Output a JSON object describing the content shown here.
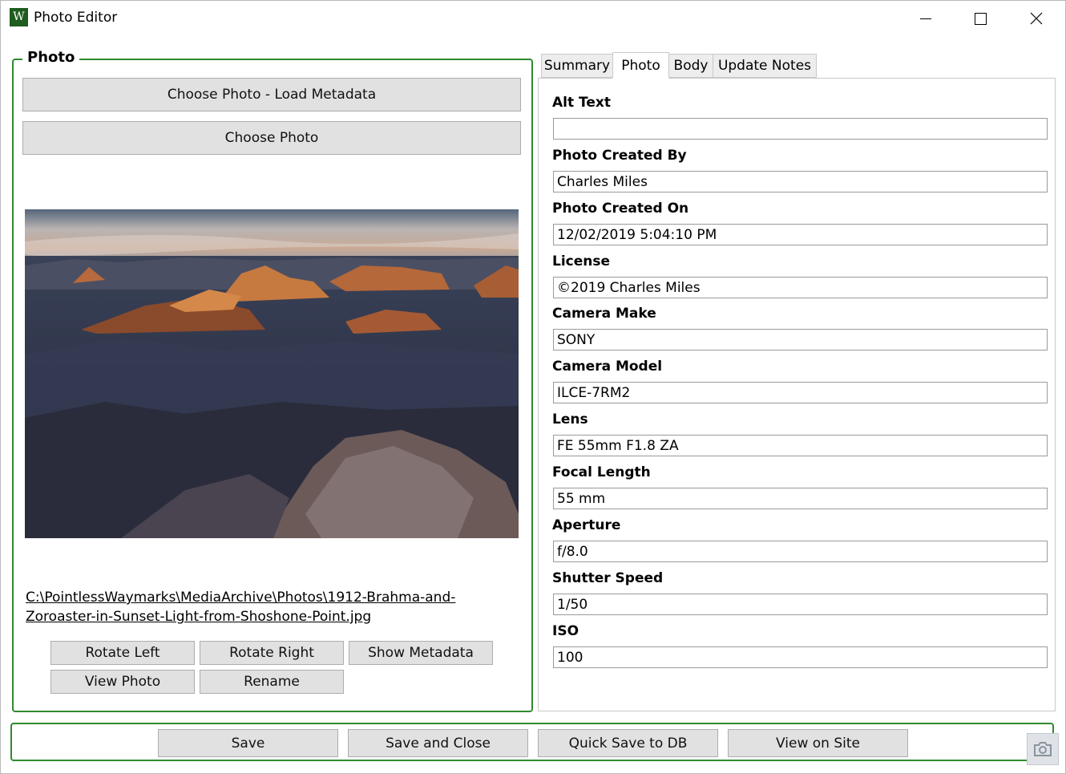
{
  "window": {
    "title": "Photo Editor",
    "icon_letter": "W"
  },
  "photo_group": {
    "legend": "Photo",
    "choose_load_metadata": "Choose Photo - Load Metadata",
    "choose_photo": "Choose Photo",
    "file_path": "C:\\PointlessWaymarks\\MediaArchive\\Photos\\1912-Brahma-and-Zoroaster-in-Sunset-Light-from-Shoshone-Point.jpg",
    "buttons": {
      "rotate_left": "Rotate Left",
      "rotate_right": "Rotate Right",
      "show_metadata": "Show Metadata",
      "view_photo": "View Photo",
      "rename": "Rename"
    }
  },
  "tabs": [
    "Summary",
    "Photo",
    "Body",
    "Update Notes"
  ],
  "active_tab": "Photo",
  "fields": [
    {
      "label": "Alt Text",
      "value": ""
    },
    {
      "label": "Photo Created By",
      "value": "Charles Miles"
    },
    {
      "label": "Photo Created On",
      "value": "12/02/2019 5:04:10 PM"
    },
    {
      "label": "License",
      "value": "©2019 Charles Miles"
    },
    {
      "label": "Camera Make",
      "value": "SONY"
    },
    {
      "label": "Camera Model",
      "value": "ILCE-7RM2"
    },
    {
      "label": "Lens",
      "value": "FE 55mm F1.8 ZA"
    },
    {
      "label": "Focal Length",
      "value": "55 mm"
    },
    {
      "label": "Aperture",
      "value": "f/8.0"
    },
    {
      "label": "Shutter Speed",
      "value": "1/50"
    },
    {
      "label": "ISO",
      "value": "100"
    }
  ],
  "bottom_buttons": {
    "save": "Save",
    "save_and_close": "Save and Close",
    "quick_save": "Quick Save to DB",
    "view_on_site": "View on Site"
  },
  "colors": {
    "group_border": "#2e8b2e",
    "button_bg": "#e1e1e1",
    "app_icon_bg": "#1f5c1f"
  }
}
